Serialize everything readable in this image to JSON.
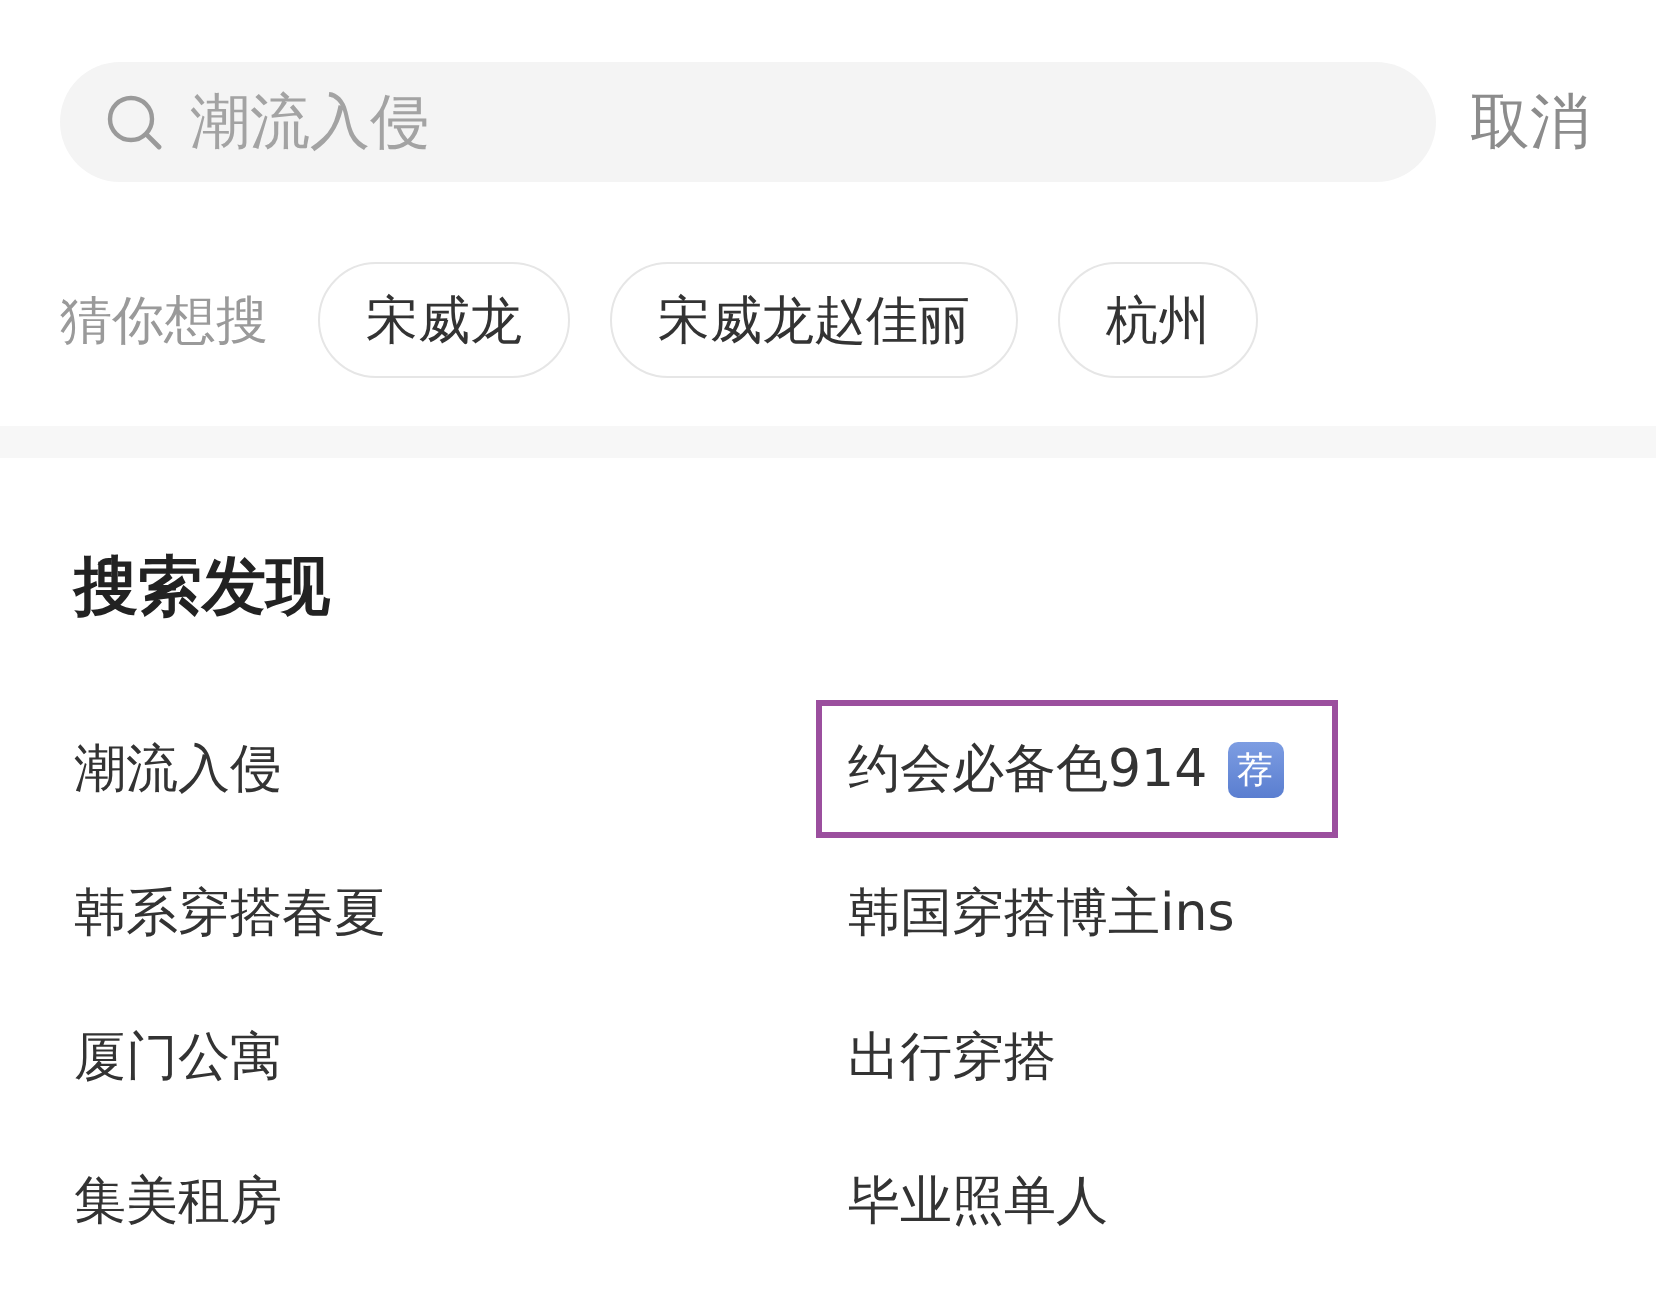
{
  "search": {
    "placeholder": "潮流入侵",
    "cancel": "取消"
  },
  "suggestions": {
    "label": "猜你想搜",
    "chips": [
      "宋威龙",
      "宋威龙赵佳丽",
      "杭州"
    ]
  },
  "discover": {
    "title": "搜索发现",
    "items": [
      {
        "text": "潮流入侵",
        "highlighted": false
      },
      {
        "text": "约会必备色914",
        "badge": "荐",
        "highlighted": true
      },
      {
        "text": "韩系穿搭春夏",
        "highlighted": false
      },
      {
        "text": "韩国穿搭博主ins",
        "highlighted": false
      },
      {
        "text": "厦门公寓",
        "highlighted": false
      },
      {
        "text": "出行穿搭",
        "highlighted": false
      },
      {
        "text": "集美租房",
        "highlighted": false
      },
      {
        "text": "毕业照单人",
        "highlighted": false
      }
    ]
  }
}
